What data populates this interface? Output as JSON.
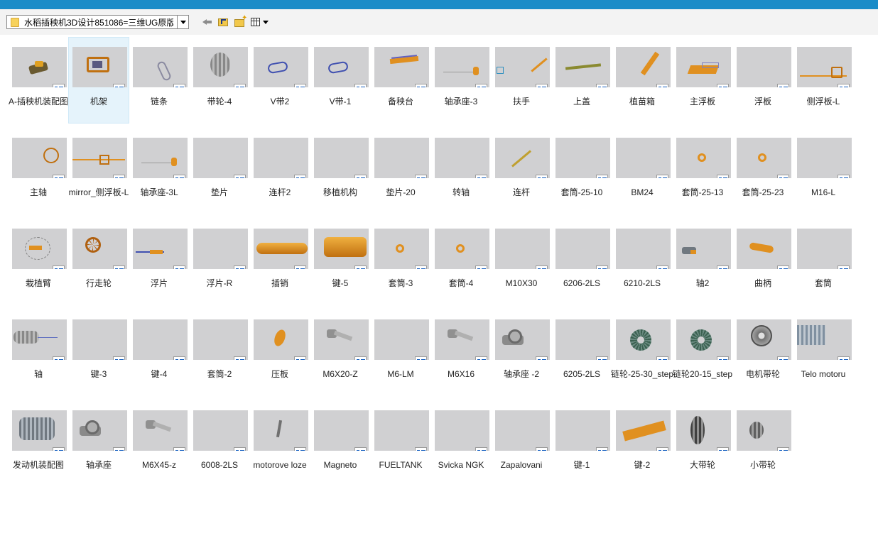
{
  "toolbar": {
    "path_text": "水稻插秧机3D设计851086=三维UG原版 三"
  },
  "accent_color": "#1a8cc8",
  "thumb_color": "#d0d0d2",
  "items": [
    {
      "label": "A-插秧机装配图",
      "icon": "assembly-thumbnail-icon"
    },
    {
      "label": "机架",
      "icon": "frame-thumbnail-icon",
      "selected": true
    },
    {
      "label": "链条",
      "icon": "chain-thumbnail-icon"
    },
    {
      "label": "带轮-4",
      "icon": "pulley-thumbnail-icon"
    },
    {
      "label": "V带2",
      "icon": "vbelt-thumbnail-icon"
    },
    {
      "label": "V带-1",
      "icon": "vbelt-thumbnail-icon"
    },
    {
      "label": "备秧台",
      "icon": "seedling-table-thumbnail-icon"
    },
    {
      "label": "轴承座-3",
      "icon": "bearing-seat-thumbnail-icon"
    },
    {
      "label": "扶手",
      "icon": "handrail-thumbnail-icon"
    },
    {
      "label": "上盖",
      "icon": "cover-thumbnail-icon"
    },
    {
      "label": "植苗箱",
      "icon": "seedling-box-thumbnail-icon"
    },
    {
      "label": "主浮板",
      "icon": "float-plate-thumbnail-icon"
    },
    {
      "label": "浮板",
      "icon": "blank-thumbnail-icon"
    },
    {
      "label": "侧浮板-L",
      "icon": "side-float-thumbnail-icon"
    },
    {
      "label": "主轴",
      "icon": "main-shaft-thumbnail-icon"
    },
    {
      "label": "mirror_侧浮板-L",
      "icon": "mirror-float-thumbnail-icon"
    },
    {
      "label": "轴承座-3L",
      "icon": "bearing-seat-thumbnail-icon"
    },
    {
      "label": "垫片",
      "icon": "blank-thumbnail-icon"
    },
    {
      "label": "连杆2",
      "icon": "blank-thumbnail-icon"
    },
    {
      "label": "移植机构",
      "icon": "blank-thumbnail-icon"
    },
    {
      "label": "垫片-20",
      "icon": "blank-thumbnail-icon"
    },
    {
      "label": "转轴",
      "icon": "blank-thumbnail-icon"
    },
    {
      "label": "连杆",
      "icon": "link-rod-thumbnail-icon"
    },
    {
      "label": "套筒-25-10",
      "icon": "blank-thumbnail-icon"
    },
    {
      "label": "BM24",
      "icon": "blank-thumbnail-icon"
    },
    {
      "label": "套筒-25-13",
      "icon": "sleeve-thumbnail-icon"
    },
    {
      "label": "套筒-25-23",
      "icon": "sleeve-thumbnail-icon"
    },
    {
      "label": "M16-L",
      "icon": "blank-thumbnail-icon"
    },
    {
      "label": "栽植臂",
      "icon": "planting-arm-thumbnail-icon"
    },
    {
      "label": "行走轮",
      "icon": "wheel-thumbnail-icon"
    },
    {
      "label": "浮片",
      "icon": "float-sheet-thumbnail-icon"
    },
    {
      "label": "浮片-R",
      "icon": "blank-thumbnail-icon"
    },
    {
      "label": "插销",
      "icon": "pin-thumbnail-icon"
    },
    {
      "label": "键-5",
      "icon": "key-thumbnail-icon"
    },
    {
      "label": "套筒-3",
      "icon": "sleeve-thumbnail-icon"
    },
    {
      "label": "套筒-4",
      "icon": "sleeve-thumbnail-icon"
    },
    {
      "label": "M10X30",
      "icon": "blank-thumbnail-icon"
    },
    {
      "label": "6206-2LS",
      "icon": "blank-thumbnail-icon"
    },
    {
      "label": "6210-2LS",
      "icon": "blank-thumbnail-icon"
    },
    {
      "label": "轴2",
      "icon": "shaft-assembly-thumbnail-icon"
    },
    {
      "label": "曲柄",
      "icon": "crank-thumbnail-icon"
    },
    {
      "label": "套筒",
      "icon": "blank-thumbnail-icon"
    },
    {
      "label": "轴",
      "icon": "shaft-thumbnail-icon"
    },
    {
      "label": "键-3",
      "icon": "blank-thumbnail-icon"
    },
    {
      "label": "键-4",
      "icon": "blank-thumbnail-icon"
    },
    {
      "label": "套筒-2",
      "icon": "blank-thumbnail-icon"
    },
    {
      "label": "压板",
      "icon": "press-plate-thumbnail-icon"
    },
    {
      "label": "M6X20-Z",
      "icon": "bolt-thumbnail-icon"
    },
    {
      "label": "M6-LM",
      "icon": "blank-thumbnail-icon"
    },
    {
      "label": "M6X16",
      "icon": "bolt-thumbnail-icon"
    },
    {
      "label": "轴承座 -2",
      "icon": "bearing-block-thumbnail-icon"
    },
    {
      "label": "6205-2LS",
      "icon": "blank-thumbnail-icon"
    },
    {
      "label": "链轮-25-30_step",
      "icon": "sprocket-thumbnail-icon"
    },
    {
      "label": "链轮20-15_step",
      "icon": "sprocket-thumbnail-icon"
    },
    {
      "label": "电机带轮",
      "icon": "motor-pulley-thumbnail-icon"
    },
    {
      "label": "Telo motoru",
      "icon": "engine-body-thumbnail-icon"
    },
    {
      "label": "发动机装配图",
      "icon": "engine-assembly-thumbnail-icon"
    },
    {
      "label": "轴承座",
      "icon": "bearing-block-thumbnail-icon"
    },
    {
      "label": "M6X45-z",
      "icon": "bolt-thumbnail-icon"
    },
    {
      "label": "6008-2LS",
      "icon": "blank-thumbnail-icon"
    },
    {
      "label": "motorove loze",
      "icon": "motor-bracket-thumbnail-icon"
    },
    {
      "label": "Magneto",
      "icon": "blank-thumbnail-icon"
    },
    {
      "label": "FUELTANK",
      "icon": "blank-thumbnail-icon"
    },
    {
      "label": "Svicka NGK",
      "icon": "blank-thumbnail-icon"
    },
    {
      "label": "Zapalovani",
      "icon": "blank-thumbnail-icon"
    },
    {
      "label": "键-1",
      "icon": "blank-thumbnail-icon"
    },
    {
      "label": "键-2",
      "icon": "key-block-thumbnail-icon"
    },
    {
      "label": "大带轮",
      "icon": "large-pulley-thumbnail-icon"
    },
    {
      "label": "小带轮",
      "icon": "small-pulley-thumbnail-icon"
    }
  ]
}
